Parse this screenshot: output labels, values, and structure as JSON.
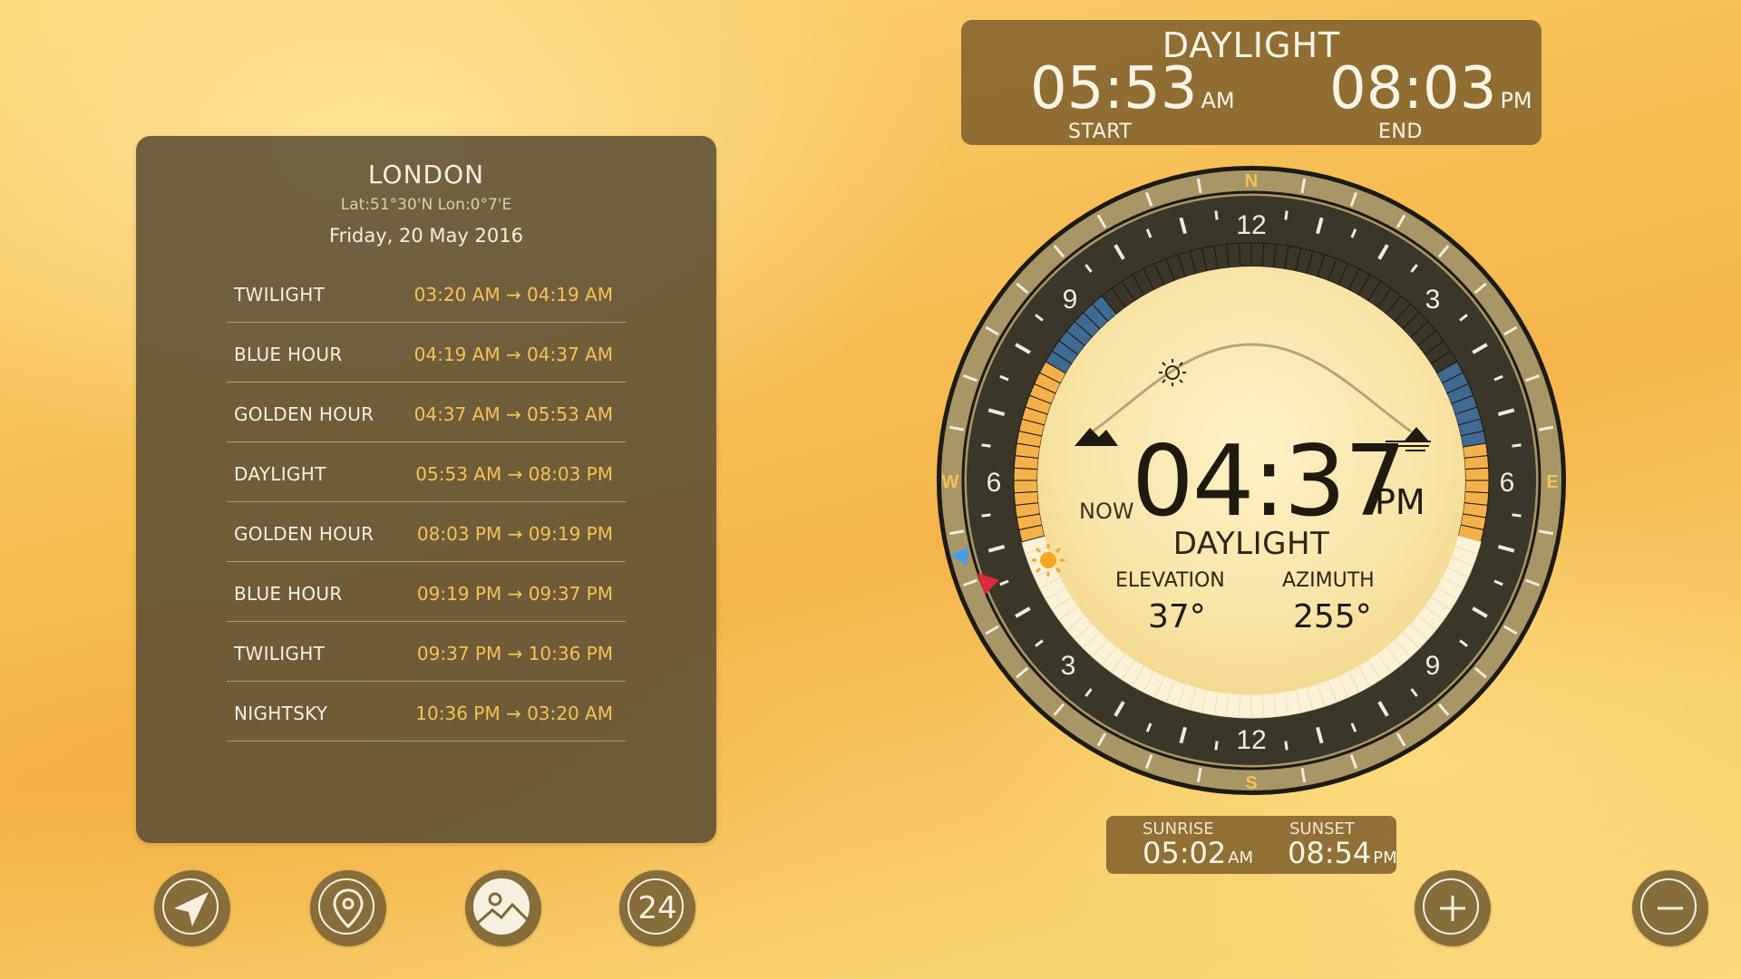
{
  "location": {
    "city": "LONDON",
    "coords": "Lat:51°30'N Lon:0°7'E",
    "date": "Friday, 20 May 2016"
  },
  "phases": [
    {
      "name": "TWILIGHT",
      "time": "03:20 AM → 04:19 AM"
    },
    {
      "name": "BLUE HOUR",
      "time": "04:19 AM → 04:37 AM"
    },
    {
      "name": "GOLDEN HOUR",
      "time": "04:37 AM → 05:53 AM"
    },
    {
      "name": "DAYLIGHT",
      "time": "05:53 AM → 08:03 PM"
    },
    {
      "name": "GOLDEN HOUR",
      "time": "08:03 PM → 09:19 PM"
    },
    {
      "name": "BLUE HOUR",
      "time": "09:19 PM → 09:37 PM"
    },
    {
      "name": "TWILIGHT",
      "time": "09:37 PM → 10:36 PM"
    },
    {
      "name": "NIGHTSKY",
      "time": "10:36 PM → 03:20 AM"
    }
  ],
  "daylight": {
    "title": "DAYLIGHT",
    "start_time": "05:53",
    "start_ampm": "AM",
    "start_label": "START",
    "end_time": "08:03",
    "end_ampm": "PM",
    "end_label": "END"
  },
  "dial": {
    "compass": {
      "n": "N",
      "e": "E",
      "s": "S",
      "w": "W"
    },
    "hours": {
      "top": "12",
      "upper_right": "3",
      "right": "6",
      "lower_right": "9",
      "bottom": "12",
      "lower_left": "3",
      "left": "6",
      "upper_left": "9"
    },
    "now_label": "NOW",
    "time": "04:37",
    "ampm": "PM",
    "phase": "DAYLIGHT",
    "elevation_label": "ELEVATION",
    "elevation_value": "37°",
    "azimuth_label": "AZIMUTH",
    "azimuth_value": "255°"
  },
  "sun_times": {
    "sunrise_label": "SUNRISE",
    "sunrise_time": "05:02",
    "sunrise_ampm": "AM",
    "sunset_label": "SUNSET",
    "sunset_time": "08:54",
    "sunset_ampm": "PM"
  },
  "buttons": {
    "hour_format_label": "24"
  },
  "colors": {
    "accent": "#f6c257",
    "panel": "#5c4e34",
    "header": "#82622e",
    "blue_hour": "#3f6a92",
    "golden_hour": "#f4b14a",
    "dial_dark": "#3a3629"
  }
}
